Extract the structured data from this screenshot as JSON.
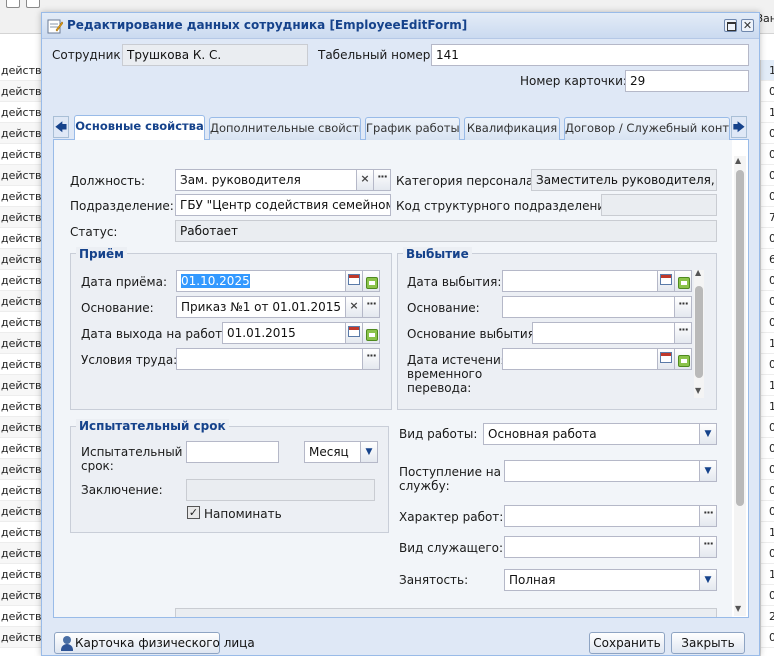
{
  "background": {
    "right_header": "Зан",
    "left_cells": [
      "действия с",
      "действия с",
      "действия с",
      "действия с",
      "действия с",
      "действия с",
      "действия с",
      "действия с",
      "действия с",
      "действия с",
      "действия с",
      "действия с",
      "действия с",
      "действия с",
      "действия с",
      "действия с",
      "действия с",
      "действия с",
      "действия с",
      "действия с",
      "действия с",
      "действия с",
      "действия с",
      "действия с",
      "действия с",
      "действия с",
      "действия с",
      "действия с"
    ],
    "right_cells": [
      "1",
      "0",
      "1",
      "0",
      "0",
      "0",
      "0",
      "7",
      "0",
      "6",
      "0",
      "0",
      "0",
      "1",
      "0",
      "1",
      "1",
      "0",
      "0",
      "0",
      "0",
      "0",
      "1",
      "0",
      "1",
      "0",
      "2",
      "0"
    ]
  },
  "window": {
    "title": "Редактирование данных сотрудника [EmployeeEditForm]",
    "close_glyph": "✕"
  },
  "header": {
    "employee_label": "Сотрудник:",
    "employee_value": "Трушкова К. С.",
    "tab_number_label": "Табельный номер:",
    "tab_number_value": "141",
    "card_number_label": "Номер карточки:",
    "card_number_value": "29"
  },
  "tabs": {
    "scroll_left": "🡄",
    "scroll_right": "🡆",
    "items": [
      {
        "label": "Основные свойства",
        "active": true
      },
      {
        "label": "Дополнительные свойства",
        "active": false
      },
      {
        "label": "График работы",
        "active": false
      },
      {
        "label": "Квалификация",
        "active": false
      },
      {
        "label": "Договор / Служебный контракт",
        "active": false
      }
    ]
  },
  "main": {
    "position_label": "Должность:",
    "position_value": "Зам. руководителя",
    "category_label": "Категория персонала:",
    "category_value": "Заместитель руководителя, руко",
    "division_label": "Подразделение:",
    "division_value": "ГБУ \"Центр содействия семейному ус",
    "struct_code_label": "Код структурного подразделения:",
    "struct_code_value": "",
    "status_label": "Статус:",
    "status_value": "Работает"
  },
  "hire": {
    "title": "Приём",
    "date_label": "Дата приёма:",
    "date_value": "01.10.2025",
    "basis_label": "Основание:",
    "basis_value": "Приказ №1 от 01.01.2015",
    "start_date_label": "Дата выхода на работу:",
    "start_date_value": "01.01.2015",
    "conditions_label": "Условия труда:",
    "conditions_value": ""
  },
  "leave": {
    "title": "Выбытие",
    "date_label": "Дата выбытия:",
    "date_value": "",
    "basis_label": "Основание:",
    "basis_value": "",
    "reason_label": "Основание выбытия:",
    "reason_value": "",
    "temp_end_label_1": "Дата истечения",
    "temp_end_label_2": "временного",
    "temp_end_label_3": "перевода:",
    "temp_end_value": ""
  },
  "probation": {
    "title": "Испытательный срок",
    "period_label_1": "Испытательный",
    "period_label_2": "срок:",
    "period_value": "",
    "unit_value": "Месяц",
    "conclusion_label": "Заключение:",
    "conclusion_value": "",
    "remind_label": "Напоминать",
    "remind_checked": true,
    "check_glyph": "✓"
  },
  "work": {
    "kind_label": "Вид работы:",
    "kind_value": "Основная работа",
    "entry_label_1": "Поступление на",
    "entry_label_2": "службу:",
    "entry_value": "",
    "nature_label": "Характер работ:",
    "nature_value": "",
    "servant_label": "Вид служащего:",
    "servant_value": "",
    "employment_label": "Занятость:",
    "employment_value": "Полная"
  },
  "glyphs": {
    "clear": "×",
    "dots": "···",
    "dropdown": "▼",
    "up": "▲",
    "down": "▼"
  },
  "footer": {
    "person_card_label": "Карточка физического лица",
    "save_label": "Сохранить",
    "close_label": "Закрыть"
  }
}
